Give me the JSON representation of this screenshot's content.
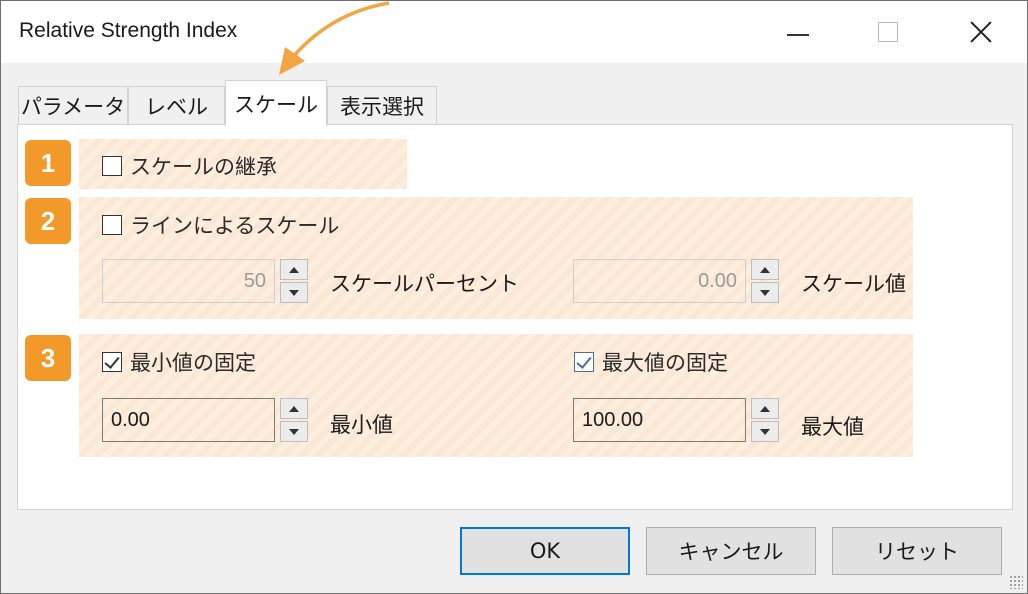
{
  "window": {
    "title": "Relative Strength Index"
  },
  "tabs": [
    {
      "label": "パラメータ"
    },
    {
      "label": "レベル"
    },
    {
      "label": "スケール"
    },
    {
      "label": "表示選択"
    }
  ],
  "sections": {
    "one": {
      "badge": "1",
      "inherit_scale_label": "スケールの継承",
      "inherit_scale_checked": false
    },
    "two": {
      "badge": "2",
      "line_scale_label": "ラインによるスケール",
      "line_scale_checked": false,
      "scale_percent_value": "50",
      "scale_percent_label": "スケールパーセント",
      "scale_value": "0.00",
      "scale_value_label": "スケール値"
    },
    "three": {
      "badge": "3",
      "fix_min_label": "最小値の固定",
      "fix_min_checked": true,
      "fix_max_label": "最大値の固定",
      "fix_max_checked": true,
      "min_value": "0.00",
      "min_label": "最小値",
      "max_value": "100.00",
      "max_label": "最大値"
    }
  },
  "buttons": {
    "ok": "OK",
    "cancel": "キャンセル",
    "reset": "リセット"
  },
  "colors": {
    "badge": "#f2992a",
    "highlight": "#fbe7d6",
    "ok_border": "#0078d7",
    "arrow": "#f2a541"
  },
  "icons": {
    "minimize": "minimize-icon",
    "maximize": "maximize-icon",
    "close": "close-icon",
    "arrow": "curved-arrow-icon",
    "spin_up": "spin-up-icon",
    "spin_down": "spin-down-icon"
  }
}
